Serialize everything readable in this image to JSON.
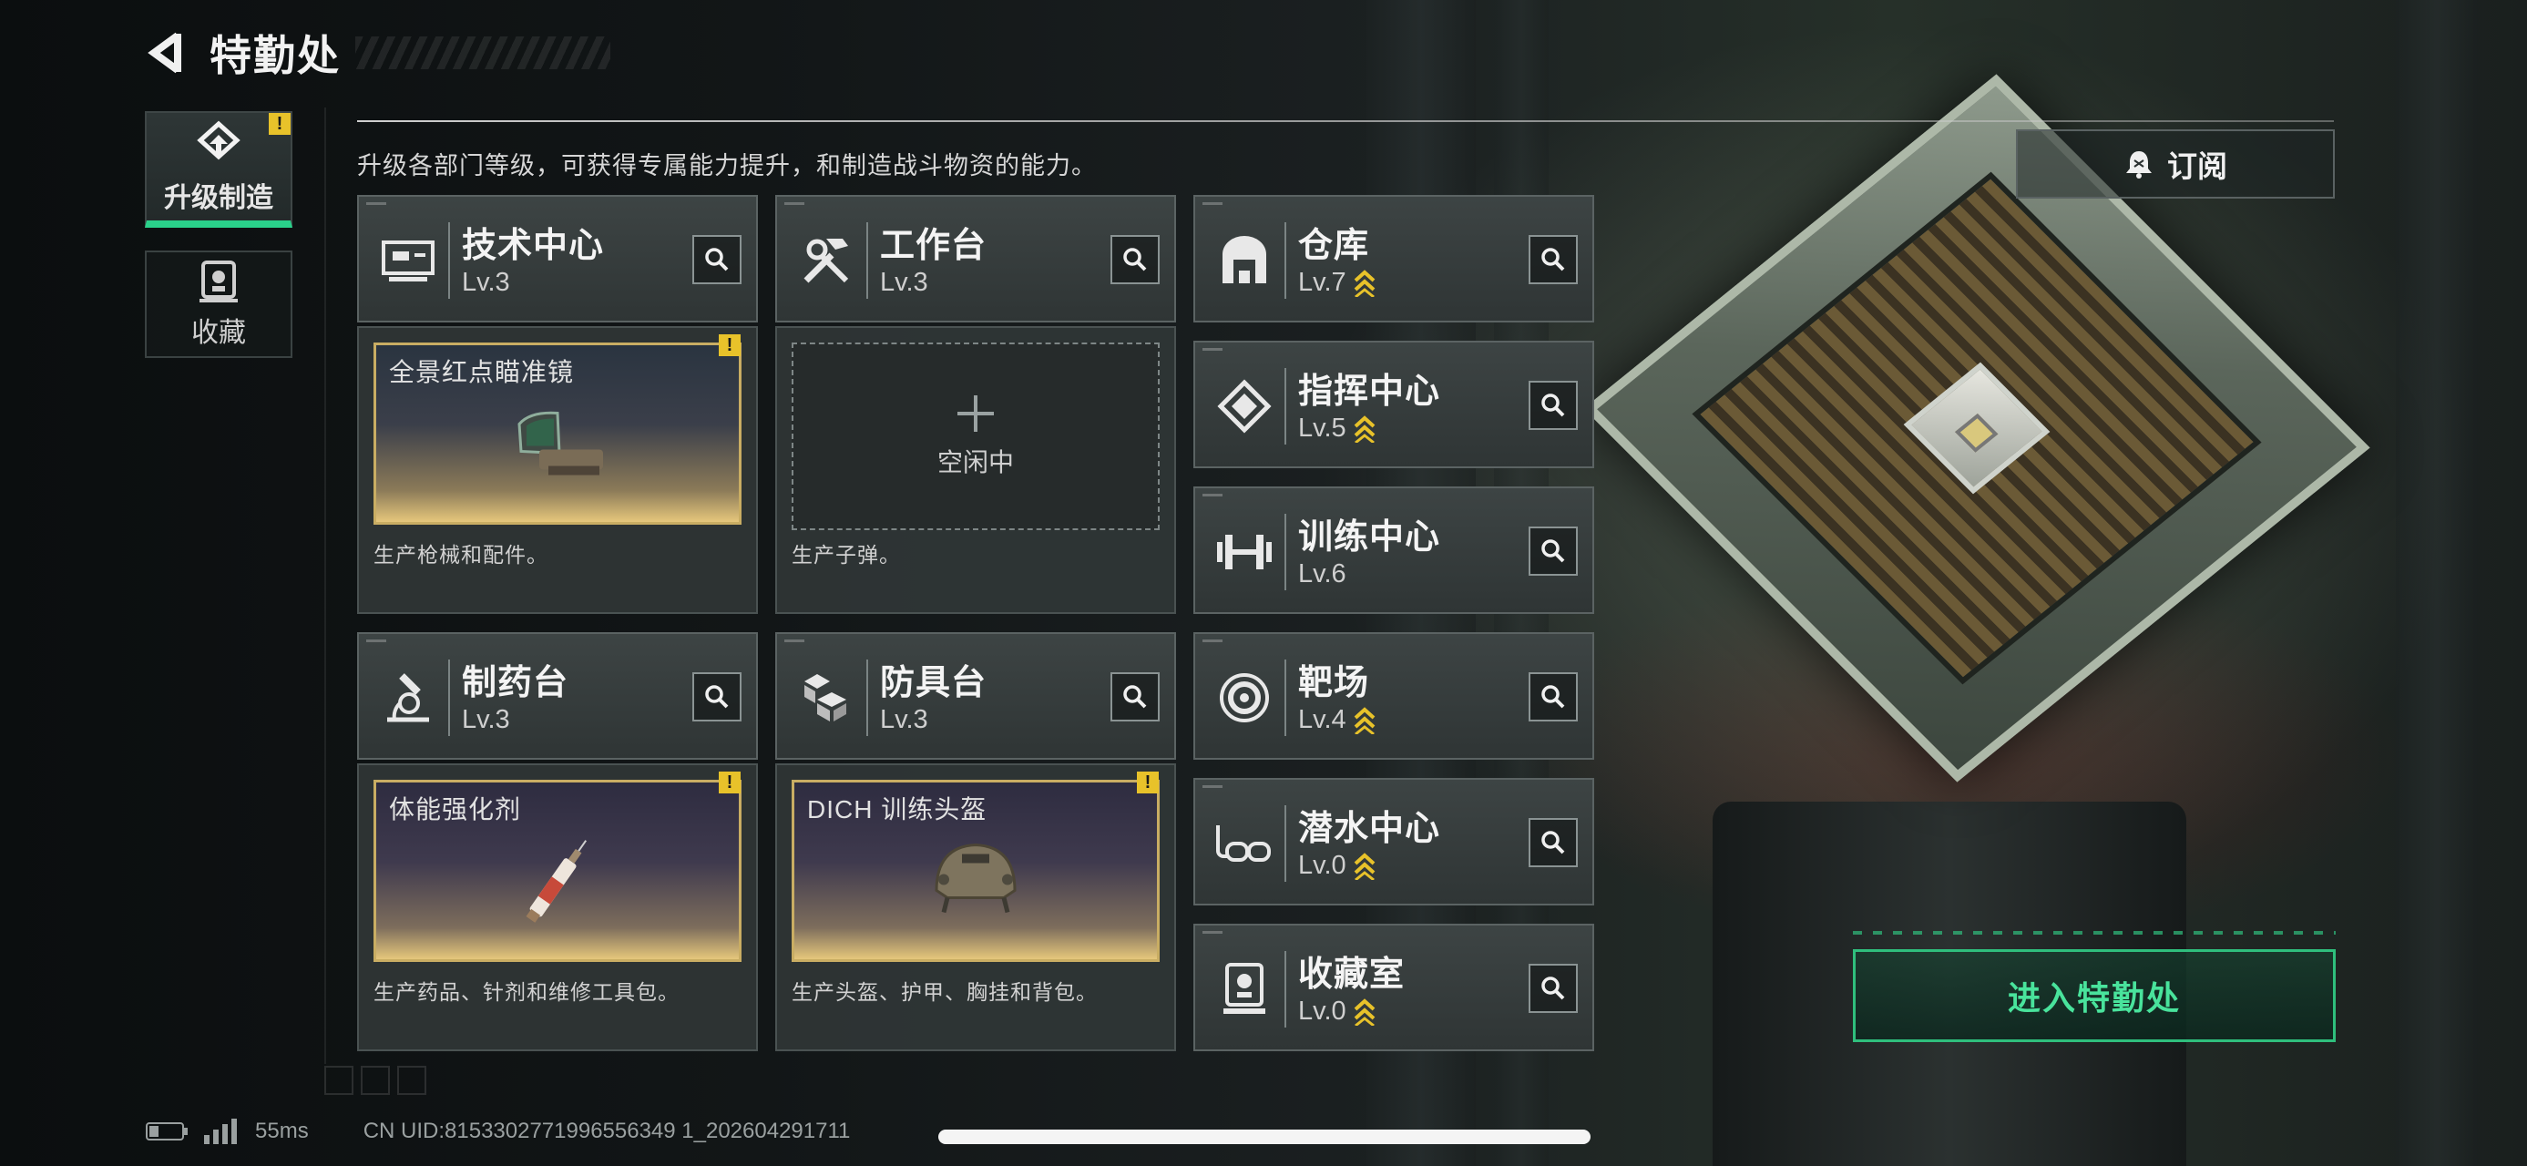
{
  "header": {
    "title": "特勤处"
  },
  "tabs": [
    {
      "label": "升级制造",
      "active": true,
      "badge": "!"
    },
    {
      "label": "收藏",
      "active": false
    }
  ],
  "description": "升级各部门等级，可获得专属能力提升，和制造战斗物资的能力。",
  "subscribe": {
    "label": "订阅"
  },
  "departments": [
    {
      "name": "技术中心",
      "level": "Lv.3",
      "icon": "tech-center-icon"
    },
    {
      "name": "工作台",
      "level": "Lv.3",
      "icon": "workbench-icon"
    },
    {
      "name": "仓库",
      "level": "Lv.7",
      "icon": "warehouse-icon",
      "upgradable": true
    },
    {
      "name": "指挥中心",
      "level": "Lv.5",
      "icon": "command-center-icon",
      "upgradable": true
    },
    {
      "name": "训练中心",
      "level": "Lv.6",
      "icon": "training-center-icon"
    },
    {
      "name": "制药台",
      "level": "Lv.3",
      "icon": "pharmacy-icon"
    },
    {
      "name": "防具台",
      "level": "Lv.3",
      "icon": "armor-bench-icon"
    },
    {
      "name": "靶场",
      "level": "Lv.4",
      "icon": "shooting-range-icon",
      "upgradable": true
    },
    {
      "name": "潜水中心",
      "level": "Lv.0",
      "icon": "diving-center-icon",
      "upgradable": true
    },
    {
      "name": "收藏室",
      "level": "Lv.0",
      "icon": "collection-room-icon",
      "upgradable": true
    }
  ],
  "production": {
    "tech": {
      "item": "全景红点瞄准镜",
      "desc": "生产枪械和配件。",
      "badge": "!"
    },
    "workbench": {
      "empty_label": "空闲中",
      "desc": "生产子弹。"
    },
    "pharmacy": {
      "item": "体能强化剂",
      "desc": "生产药品、针剂和维修工具包。",
      "badge": "!"
    },
    "armor": {
      "item": "DICH 训练头盔",
      "desc": "生产头盔、护甲、胸挂和背包。",
      "badge": "!"
    }
  },
  "enter_button": {
    "label": "进入特勤处"
  },
  "footer": {
    "ping": "55ms",
    "uid": "CN UID:8153302771996556349 1_202604291711"
  },
  "colors": {
    "accent": "#2ad18a",
    "warning": "#e8c22a",
    "gold": "#e6c77b"
  }
}
